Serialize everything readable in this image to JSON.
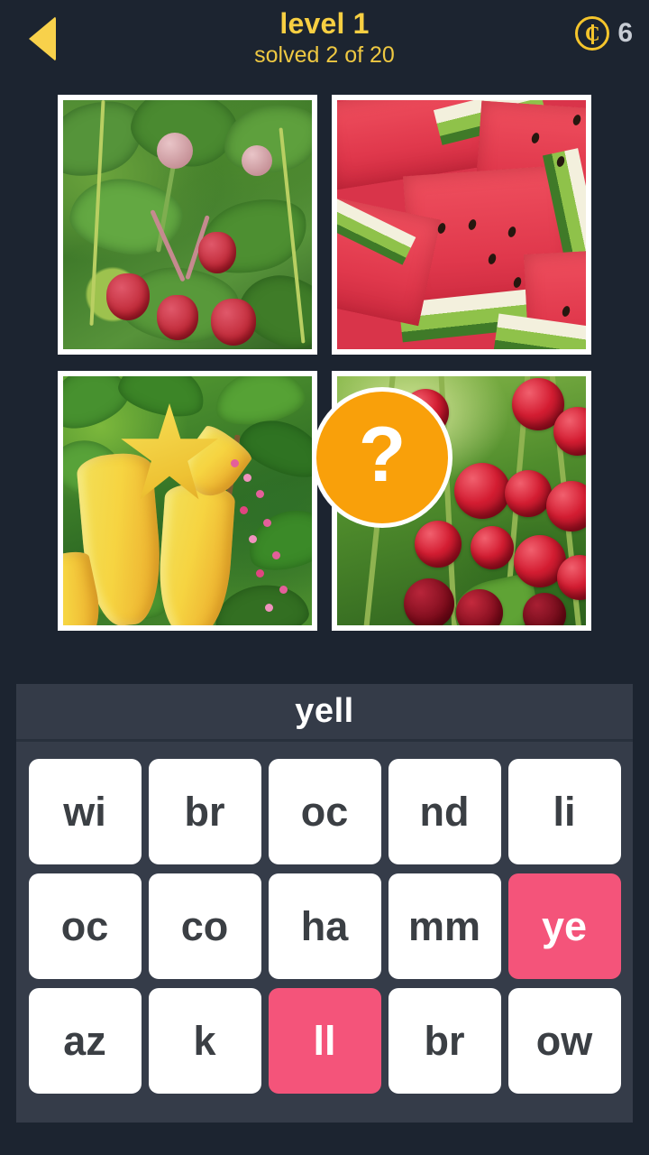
{
  "header": {
    "back_icon": "back-arrow-icon",
    "title": "level 1",
    "subtitle": "solved 2 of 20",
    "coin_icon": "coin-icon",
    "coin_count": "6",
    "title_color": "#f7cf42",
    "subtitle_color": "#eec842",
    "coin_color": "#f5c52c",
    "count_color": "#c7ccd4"
  },
  "puzzle": {
    "hint_badge": {
      "icon": "question-mark-icon",
      "label": "?",
      "color": "#f9a00a"
    },
    "images": [
      {
        "position": "top-left",
        "alt": "wild strawberries growing among green leaves"
      },
      {
        "position": "top-right",
        "alt": "sliced red watermelon wedges with green rind"
      },
      {
        "position": "bottom-left",
        "alt": "yellow starfruit carambola hanging on tree with pink blossoms"
      },
      {
        "position": "bottom-right",
        "alt": "clusters of red currant berries on stems"
      }
    ]
  },
  "answer": {
    "current_word": "yell"
  },
  "keyboard": {
    "rows": [
      [
        {
          "label": "wi",
          "used": false
        },
        {
          "label": "br",
          "used": false
        },
        {
          "label": "oc",
          "used": false
        },
        {
          "label": "nd",
          "used": false
        },
        {
          "label": "li",
          "used": false
        }
      ],
      [
        {
          "label": "oc",
          "used": false
        },
        {
          "label": "co",
          "used": false
        },
        {
          "label": "ha",
          "used": false
        },
        {
          "label": "mm",
          "used": false
        },
        {
          "label": "ye",
          "used": true
        }
      ],
      [
        {
          "label": "az",
          "used": false
        },
        {
          "label": "k",
          "used": false
        },
        {
          "label": "ll",
          "used": true
        },
        {
          "label": "br",
          "used": false
        },
        {
          "label": "ow",
          "used": false
        }
      ]
    ],
    "tile_color": "#ffffff",
    "tile_used_color": "#f4547a"
  },
  "theme": {
    "background": "#1c2430",
    "panel": "#353c49"
  }
}
